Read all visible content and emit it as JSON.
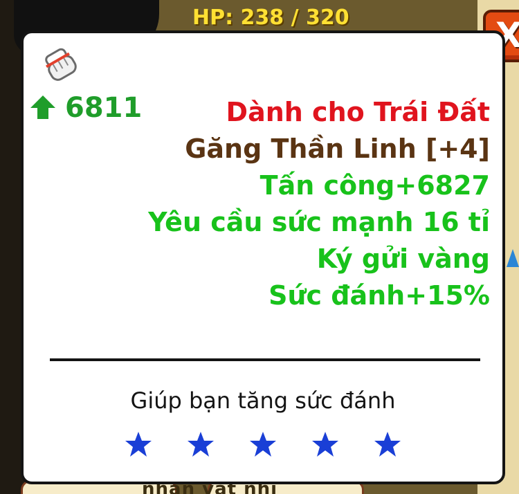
{
  "hud": {
    "hp_text": "HP: 238 / 320"
  },
  "close_label": "X",
  "item": {
    "icon": "glove-icon",
    "power": "6811",
    "power_icon": "up-arrow-icon",
    "lines": [
      {
        "text": "Dành cho Trái Đất",
        "color": "#e0141e"
      },
      {
        "text": "Găng Thần Linh [+4]",
        "color": "#5a3413"
      },
      {
        "text": "Tấn công+6827",
        "color": "#18c21b"
      },
      {
        "text": "Yêu cầu sức mạnh 16 tỉ",
        "color": "#18c21b"
      },
      {
        "text": "Ký gửi vàng",
        "color": "#18c21b"
      },
      {
        "text": "Sức đánh+15%",
        "color": "#18c21b"
      }
    ],
    "description": "Giúp bạn tăng sức đánh",
    "stars": 5,
    "star_color": "#1a3fd6"
  },
  "background_text": "nhan vat nhi"
}
